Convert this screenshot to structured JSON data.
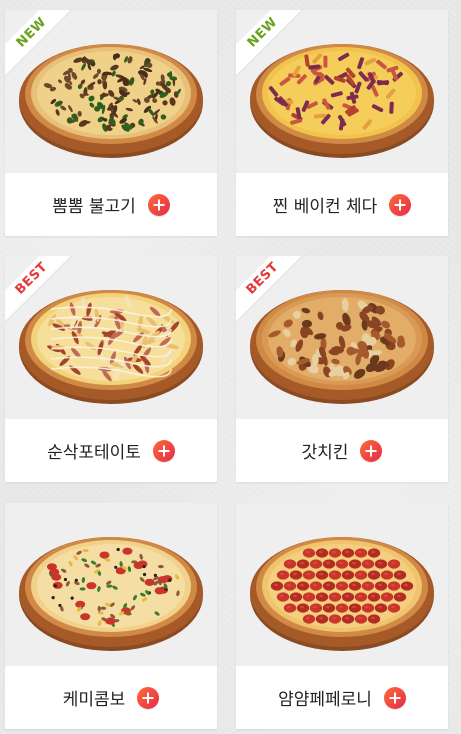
{
  "menu": {
    "items": [
      {
        "name": "뽐뽐 불고기",
        "badge": "NEW",
        "badge_color": "#6aa31a",
        "pizza": "bulgogi",
        "add_icon": "plus-icon"
      },
      {
        "name": "찐 베이컨 체다",
        "badge": "NEW",
        "badge_color": "#6aa31a",
        "pizza": "bacon-cheddar",
        "add_icon": "plus-icon"
      },
      {
        "name": "순삭포테이토",
        "badge": "BEST",
        "badge_color": "#e53a3a",
        "pizza": "potato",
        "add_icon": "plus-icon"
      },
      {
        "name": "갓치킨",
        "badge": "BEST",
        "badge_color": "#e53a3a",
        "pizza": "chicken",
        "add_icon": "plus-icon"
      },
      {
        "name": "케미콤보",
        "badge": "",
        "badge_color": "",
        "pizza": "combo",
        "add_icon": "plus-icon"
      },
      {
        "name": "얌얌페페로니",
        "badge": "",
        "badge_color": "",
        "pizza": "pepperoni",
        "add_icon": "plus-icon"
      }
    ]
  },
  "colors": {
    "add_button_start": "#ff6a3a",
    "add_button_end": "#e62a47",
    "new_badge": "#6aa31a",
    "best_badge": "#e53a3a"
  }
}
